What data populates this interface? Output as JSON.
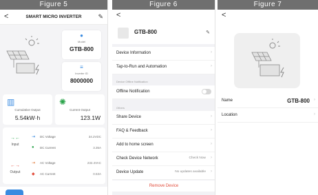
{
  "fig5": {
    "title": "Figure 5",
    "header": {
      "back": "<",
      "title": "SMART MICRO INVERTER",
      "edit": "✎"
    },
    "model": {
      "label": "Model",
      "value": "GTB-800"
    },
    "inverter_id": {
      "label": "Inverter ID",
      "value": "8000000"
    },
    "cumulative": {
      "label": "Cumulative Output",
      "value": "5.54kW·h"
    },
    "current": {
      "label": "Current Output",
      "value": "123.1W"
    },
    "input": {
      "label": "Input",
      "rows": [
        {
          "label": "DC Voltage",
          "value": "34.2VDC"
        },
        {
          "label": "DC Current",
          "value": "3.35A"
        }
      ]
    },
    "output": {
      "label": "Output",
      "rows": [
        {
          "label": "AC Voltage",
          "value": "232.4VAC"
        },
        {
          "label": "AC Current",
          "value": "0.53A"
        }
      ]
    }
  },
  "fig6": {
    "title": "Figure 6",
    "back": "<",
    "device_name": "GTB-800",
    "edit": "✎",
    "rows_top": [
      {
        "label": "Device Information"
      },
      {
        "label": "Tap-to-Run and Automation"
      }
    ],
    "offline_section": "Device Offline Notification",
    "offline_row": {
      "label": "Offline Notification",
      "on": false
    },
    "others_section": "Others",
    "rows_others": [
      {
        "label": "Share Device",
        "value": ""
      },
      {
        "label": "FAQ & Feedback",
        "value": ""
      },
      {
        "label": "Add to home screen",
        "value": ""
      },
      {
        "label": "Check Device Network",
        "value": "Check Now"
      },
      {
        "label": "Device Update",
        "value": "No updates available"
      }
    ],
    "remove": "Remove Device"
  },
  "fig7": {
    "title": "Figure 7",
    "back": "<",
    "rows": [
      {
        "label": "Name",
        "value": "GTB-800"
      },
      {
        "label": "Location",
        "value": ""
      }
    ]
  },
  "colors": {
    "accent": "#3a8be0",
    "green": "#2aa34a",
    "danger": "#e24b3a",
    "figure_bar": "#6f6f6f"
  }
}
